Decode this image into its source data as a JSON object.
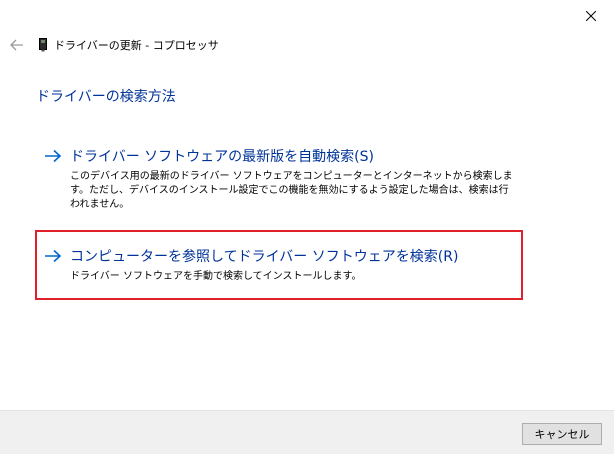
{
  "window": {
    "title": "ドライバーの更新 - コプロセッサ",
    "close_icon": "close-icon",
    "back_icon": "back-arrow-icon",
    "device_icon": "device-icon"
  },
  "page": {
    "heading": "ドライバーの検索方法"
  },
  "options": [
    {
      "icon": "arrow-right-icon",
      "title": "ドライバー ソフトウェアの最新版を自動検索(S)",
      "description": "このデバイス用の最新のドライバー ソフトウェアをコンピューターとインターネットから検索します。ただし、デバイスのインストール設定でこの機能を無効にするよう設定した場合は、検索は行われません。"
    },
    {
      "icon": "arrow-right-icon",
      "title": "コンピューターを参照してドライバー ソフトウェアを検索(R)",
      "description": "ドライバー ソフトウェアを手動で検索してインストールします。"
    }
  ],
  "footer": {
    "cancel_label": "キャンセル"
  },
  "colors": {
    "link_blue": "#003399",
    "arrow_blue": "#0066cc",
    "highlight_red": "#e0202a",
    "footer_bg": "#f0f0f0"
  }
}
